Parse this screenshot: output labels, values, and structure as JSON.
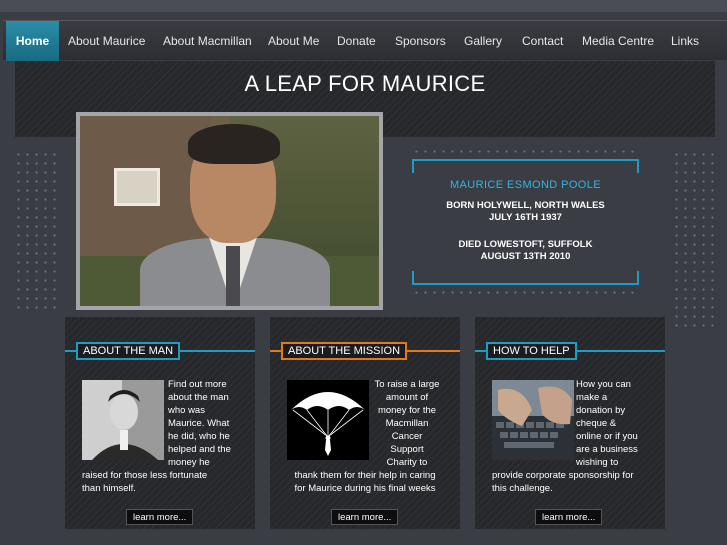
{
  "nav": {
    "items": [
      {
        "label": "Home",
        "active": true
      },
      {
        "label": "About Maurice",
        "active": false
      },
      {
        "label": "About Macmillan",
        "active": false
      },
      {
        "label": "About Me",
        "active": false
      },
      {
        "label": "Donate",
        "active": false
      },
      {
        "label": "Sponsors",
        "active": false
      },
      {
        "label": "Gallery",
        "active": false
      },
      {
        "label": "Contact",
        "active": false
      },
      {
        "label": "Media Centre",
        "active": false
      },
      {
        "label": "Links",
        "active": false
      }
    ]
  },
  "banner": {
    "title": "A LEAP FOR MAURICE"
  },
  "info": {
    "name": "MAURICE ESMOND POOLE",
    "born_line1": "BORN HOLYWELL, NORTH WALES",
    "born_line2": "JULY 16TH 1937",
    "died_line1": "DIED LOWESTOFT, SUFFOLK",
    "died_line2": "AUGUST 13TH 2010"
  },
  "panels": [
    {
      "title": "ABOUT THE MAN",
      "accent": "#1f9cc4",
      "text_lines": [
        "Find out more",
        "about the man",
        "who was",
        "Maurice. What",
        "he did, who he",
        "helped and the",
        "money he"
      ],
      "text_wide": [
        "raised for those less fortunate",
        "than himself."
      ],
      "button": "learn more..."
    },
    {
      "title": "ABOUT THE MISSION",
      "accent": "#e07a1a",
      "text_lines": [
        "To raise a large",
        "amount of",
        "money for the",
        "Macmillan",
        "Cancer",
        "Support",
        "Charity to"
      ],
      "text_wide": [
        "thank them for their help in caring",
        "for Maurice during his final weeks"
      ],
      "button": "learn more..."
    },
    {
      "title": "HOW TO HELP",
      "accent": "#1f9cc4",
      "text_lines": [
        "How you can",
        "make a",
        "donation by",
        "cheque &",
        "online or if you",
        "are a business",
        "wishing to"
      ],
      "text_wide": [
        "provide corporate sponsorship for",
        "this challenge."
      ],
      "button": "learn more..."
    }
  ]
}
